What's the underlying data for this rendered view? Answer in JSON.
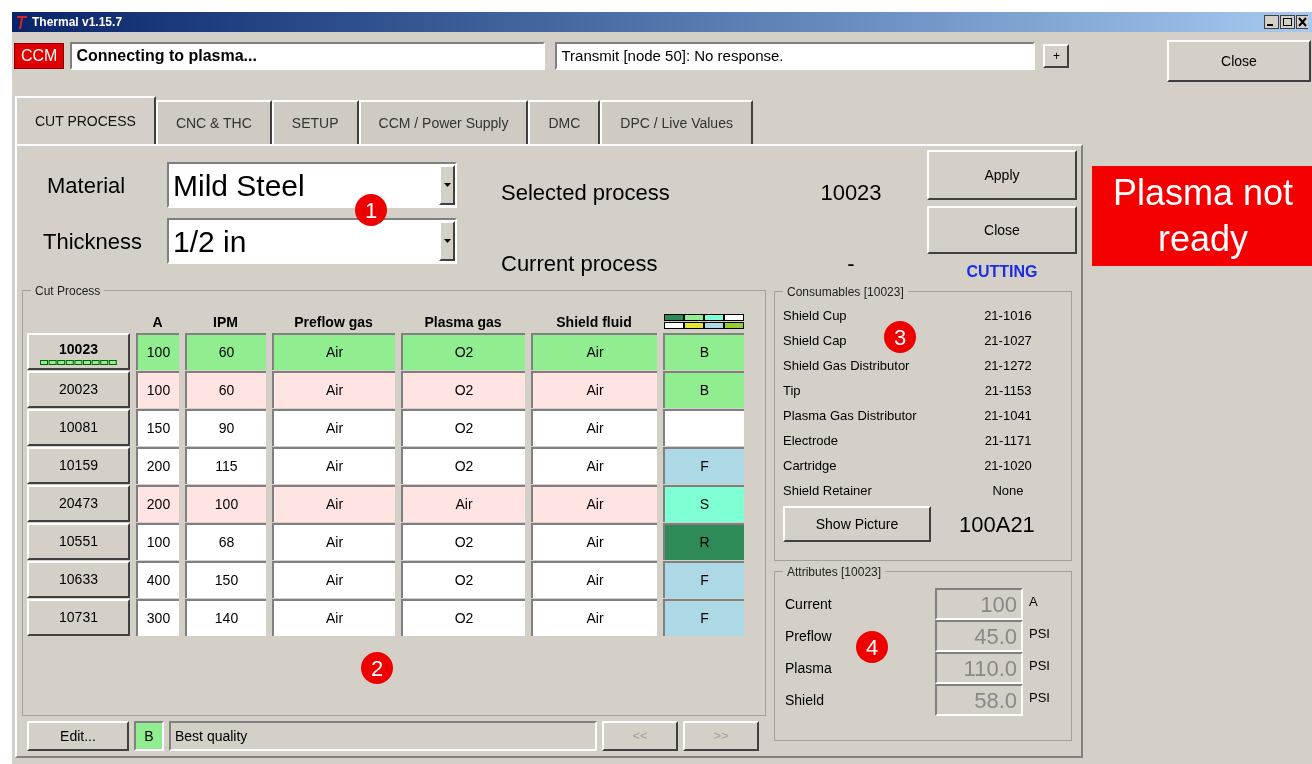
{
  "window": {
    "title": "Thermal v1.15.7"
  },
  "status_bar": {
    "badge": "CCM",
    "message": "Connecting to plasma...",
    "transmit": "Transmit [node 50]: No response.",
    "expand_button": "+"
  },
  "close_button": "Close",
  "plasma_status": {
    "text": "Plasma not ready",
    "ready": false
  },
  "tabs": [
    {
      "label": "CUT PROCESS",
      "selected": true
    },
    {
      "label": "CNC & THC",
      "selected": false
    },
    {
      "label": "SETUP",
      "selected": false
    },
    {
      "label": "CCM / Power Supply",
      "selected": false
    },
    {
      "label": "DMC",
      "selected": false
    },
    {
      "label": "DPC / Live Values",
      "selected": false
    }
  ],
  "process_selector": {
    "material_label": "Material",
    "material": "Mild Steel",
    "thickness_label": "Thickness",
    "thickness": "1/2 in",
    "selected_label": "Selected process",
    "selected_value": "10023",
    "current_label": "Current process",
    "current_value": "-"
  },
  "actions": {
    "apply": "Apply",
    "close": "Close",
    "mode": "CUTTING"
  },
  "cut_process": {
    "title": "Cut Process",
    "columns": [
      "A",
      "IPM",
      "Preflow gas",
      "Plasma gas",
      "Shield fluid"
    ],
    "rows": [
      {
        "id": "10023",
        "selected": true,
        "color": "#90ee90",
        "cells": [
          "100",
          "60",
          "Air",
          "O2",
          "Air"
        ],
        "quality": {
          "text": "B",
          "color": "#90ee90"
        }
      },
      {
        "id": "20023",
        "selected": false,
        "color": "#ffe4e1",
        "cells": [
          "100",
          "60",
          "Air",
          "O2",
          "Air"
        ],
        "quality": {
          "text": "B",
          "color": "#90ee90"
        }
      },
      {
        "id": "10081",
        "selected": false,
        "color": "#ffffff",
        "cells": [
          "150",
          "90",
          "Air",
          "O2",
          "Air"
        ],
        "quality": {
          "color": "#ffffff"
        }
      },
      {
        "id": "10159",
        "selected": false,
        "color": "#ffffff",
        "cells": [
          "200",
          "115",
          "Air",
          "O2",
          "Air"
        ],
        "quality": {
          "text": "F",
          "color": "#add8e6"
        }
      },
      {
        "id": "20473",
        "selected": false,
        "color": "#ffe4e1",
        "cells": [
          "200",
          "100",
          "Air",
          "Air",
          "Air"
        ],
        "quality": {
          "text": "S",
          "color": "#7fffd4"
        }
      },
      {
        "id": "10551",
        "selected": false,
        "color": "#ffffff",
        "cells": [
          "100",
          "68",
          "Air",
          "O2",
          "Air"
        ],
        "quality": {
          "text": "R",
          "color": "#2e8b57"
        }
      },
      {
        "id": "10633",
        "selected": false,
        "color": "#ffffff",
        "cells": [
          "400",
          "150",
          "Air",
          "O2",
          "Air"
        ],
        "quality": {
          "text": "F",
          "color": "#add8e6"
        }
      },
      {
        "id": "10731",
        "selected": false,
        "color": "#ffffff",
        "cells": [
          "300",
          "140",
          "Air",
          "O2",
          "Air"
        ],
        "quality": {
          "text": "F",
          "color": "#add8e6"
        }
      }
    ]
  },
  "footer": {
    "edit": "Edit...",
    "quality": {
      "text": "B",
      "color": "#90ee90"
    },
    "description": "Best quality",
    "prev": "<<",
    "next": ">>",
    "nav_disabled": true
  },
  "consumables": {
    "title": "Consumables [10023]",
    "items": [
      {
        "name": "Shield Cup",
        "part": "21-1016"
      },
      {
        "name": "Shield Cap",
        "part": "21-1027"
      },
      {
        "name": "Shield Gas Distributor",
        "part": "21-1272"
      },
      {
        "name": "Tip",
        "part": "21-1153"
      },
      {
        "name": "Plasma Gas Distributor",
        "part": "21-1041"
      },
      {
        "name": "Electrode",
        "part": "21-1171"
      },
      {
        "name": "Cartridge",
        "part": "21-1020"
      },
      {
        "name": "Shield Retainer",
        "part": "None"
      }
    ],
    "show_picture": "Show Picture",
    "code": "100A21"
  },
  "attributes": {
    "title": "Attributes [10023]",
    "items": [
      {
        "name": "Current",
        "value": "100",
        "unit": "A"
      },
      {
        "name": "Preflow",
        "value": "45.0",
        "unit": "PSI"
      },
      {
        "name": "Plasma",
        "value": "110.0",
        "unit": "PSI"
      },
      {
        "name": "Shield",
        "value": "58.0",
        "unit": "PSI"
      }
    ]
  },
  "callouts": [
    "1",
    "2",
    "3",
    "4"
  ]
}
